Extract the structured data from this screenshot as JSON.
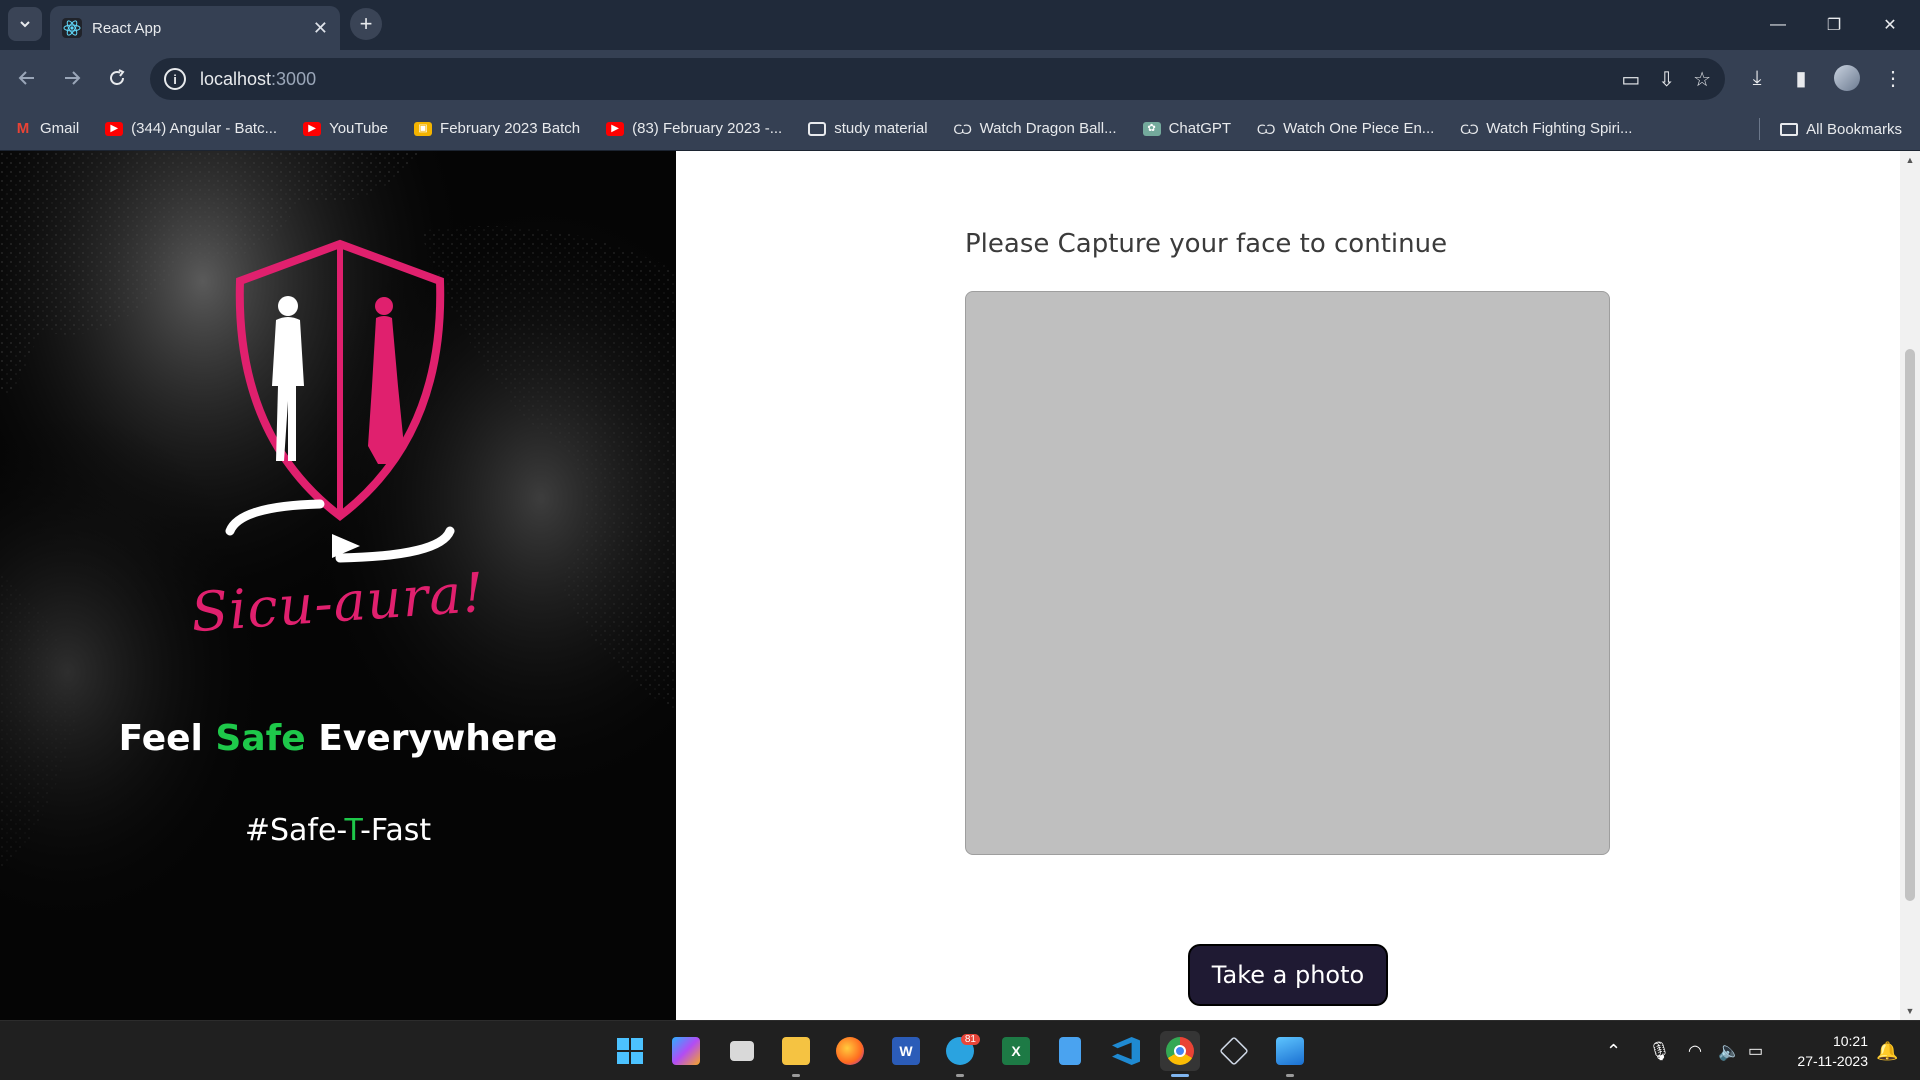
{
  "browser": {
    "tab_title": "React App",
    "url_host": "localhost",
    "url_port": ":3000",
    "bookmarks": [
      {
        "label": "Gmail",
        "icon": "gmail-icon"
      },
      {
        "label": "(344) Angular - Batc...",
        "icon": "youtube-icon"
      },
      {
        "label": "YouTube",
        "icon": "youtube-icon"
      },
      {
        "label": "February 2023 Batch",
        "icon": "classroom-icon"
      },
      {
        "label": "(83) February 2023 -...",
        "icon": "youtube-icon"
      },
      {
        "label": "study material",
        "icon": "folder-icon"
      },
      {
        "label": "Watch Dragon Ball...",
        "icon": "anime-icon"
      },
      {
        "label": "ChatGPT",
        "icon": "chatgpt-icon"
      },
      {
        "label": "Watch One Piece En...",
        "icon": "anime-icon"
      },
      {
        "label": "Watch Fighting Spiri...",
        "icon": "anime-icon"
      }
    ],
    "all_bookmarks": "All Bookmarks"
  },
  "page": {
    "brand": "Sicu-aura!",
    "tagline_pre": "Feel ",
    "tagline_highlight": "Safe",
    "tagline_post": " Everywhere",
    "hashtag_pre": "#Safe-",
    "hashtag_highlight": "T",
    "hashtag_post": "-Fast",
    "capture_prompt": "Please Capture your face to continue",
    "take_photo_label": "Take a photo"
  },
  "colors": {
    "brand_pink": "#e0206e",
    "highlight_green": "#1ec84a",
    "button_bg": "#1f1a33",
    "camera_placeholder": "#bfbfbf"
  },
  "taskbar": {
    "telegram_badge": "81",
    "time": "10:21",
    "date": "27-11-2023"
  }
}
